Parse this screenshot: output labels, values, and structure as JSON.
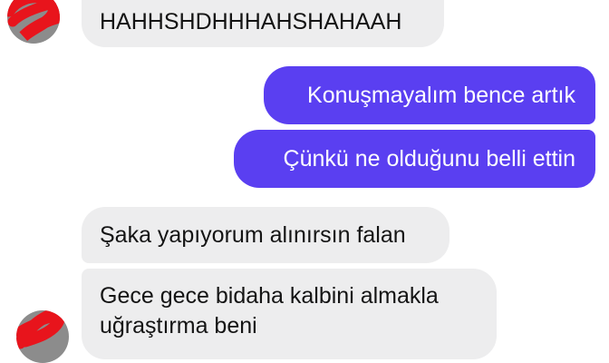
{
  "messages": [
    {
      "id": "m1",
      "side": "incoming",
      "text": "HAHHSHDHHHAHSHAHAAH"
    },
    {
      "id": "m2",
      "side": "outgoing",
      "text": "Konuşmayalım bence artık"
    },
    {
      "id": "m3",
      "side": "outgoing",
      "text": "Çünkü ne olduğunu belli ettin"
    },
    {
      "id": "m4",
      "side": "incoming",
      "text": "Şaka yapıyorum alınırsın falan"
    },
    {
      "id": "m5",
      "side": "incoming",
      "text": "Gece gece bidaha kalbini almakla uğraştırma beni"
    }
  ],
  "colors": {
    "outgoing_bubble": "#5a3ff1",
    "incoming_bubble": "#ededee",
    "redaction": "#e8141c"
  },
  "icons": {
    "avatar_redacted": "redacted-avatar-icon"
  }
}
